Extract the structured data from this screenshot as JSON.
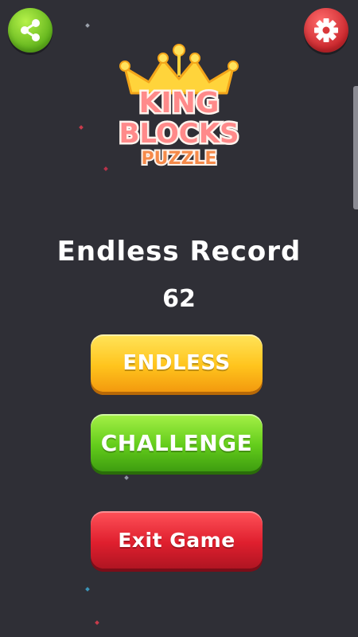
{
  "header": {
    "share_icon": "share-icon",
    "settings_icon": "gear-icon"
  },
  "logo": {
    "line1": "KING",
    "line2": "BLOCKS",
    "line3": "PUZZLE"
  },
  "record": {
    "title": "Endless Record",
    "value": "62"
  },
  "buttons": {
    "endless": "ENDLESS",
    "challenge": "CHALLENGE",
    "exit": "Exit Game"
  },
  "colors": {
    "background": "#2f2f36",
    "endless": "#ffc41d",
    "challenge": "#63cc1b",
    "exit": "#df1f2e",
    "share": "#6cc020",
    "settings": "#d9383a"
  }
}
